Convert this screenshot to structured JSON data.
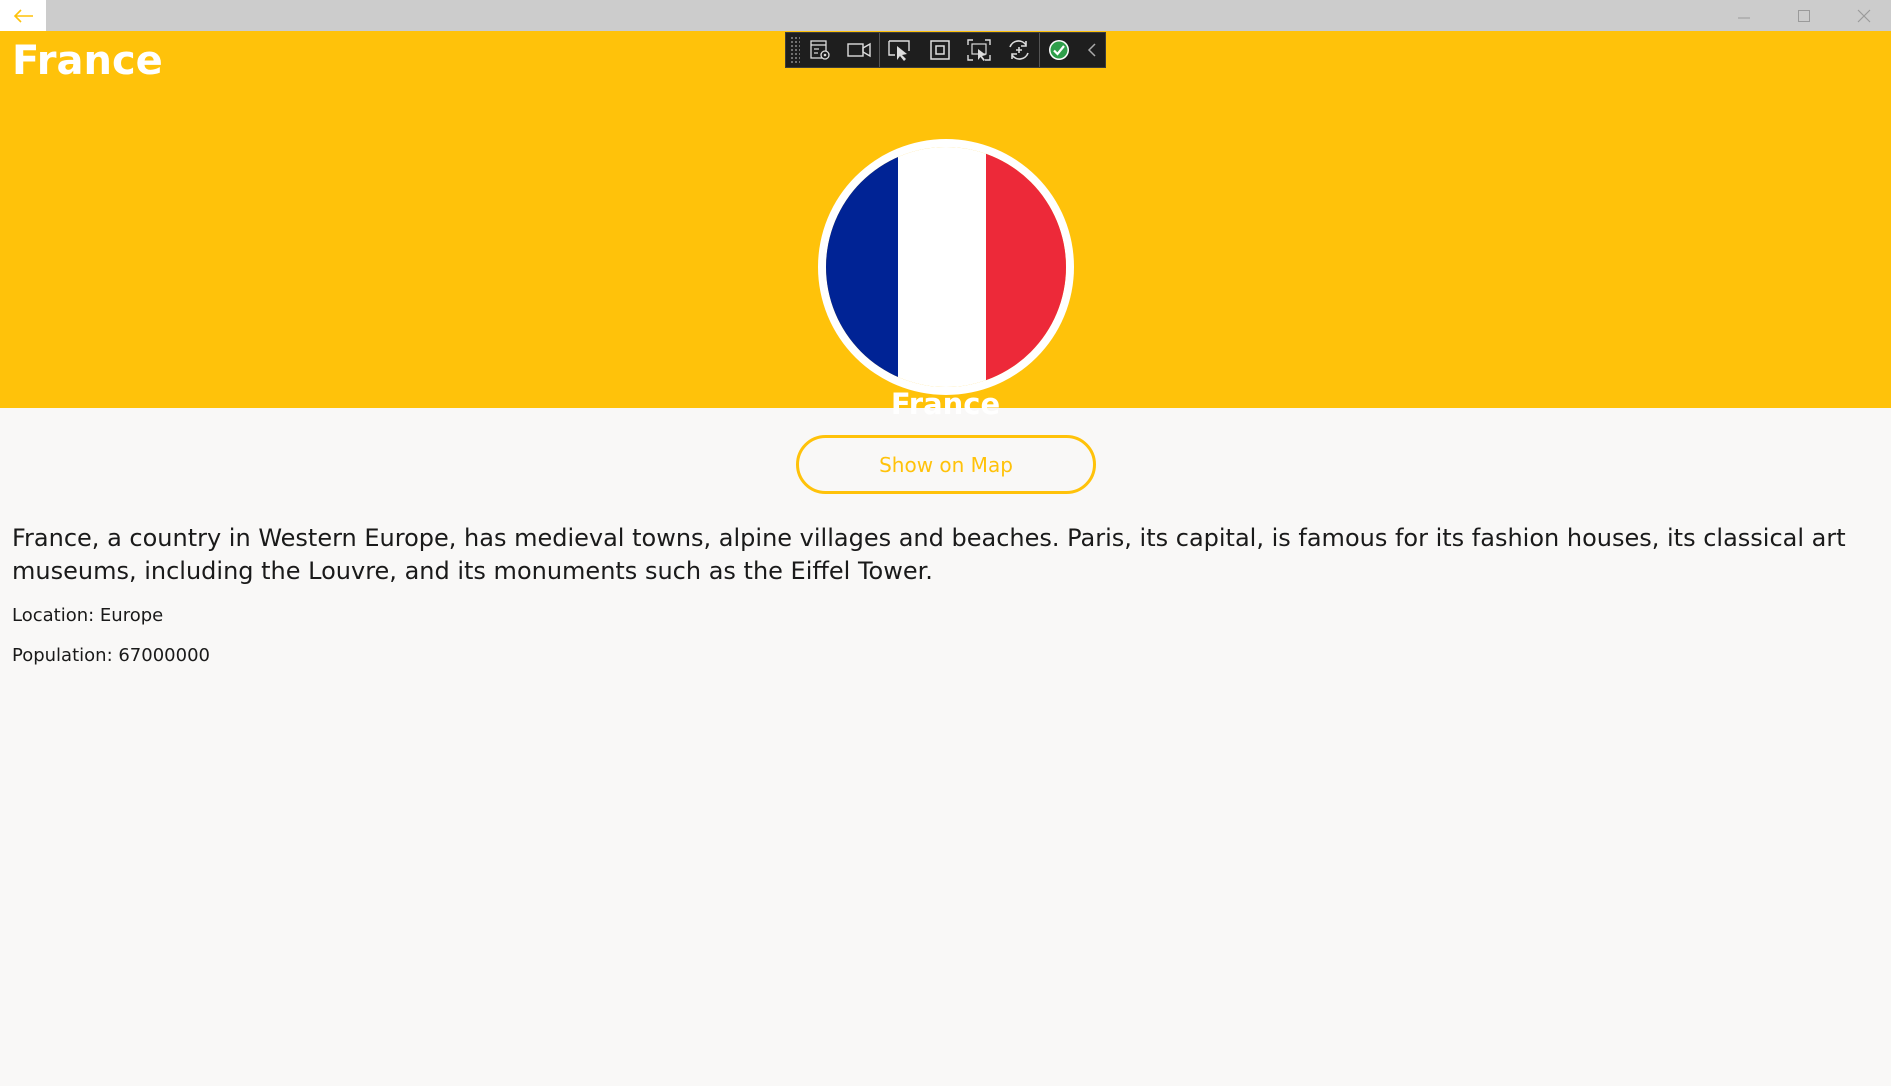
{
  "window": {
    "title": "France",
    "back_icon": "back-arrow-icon",
    "controls": [
      "minimize-icon",
      "maximize-icon",
      "close-icon"
    ]
  },
  "devtools_toolbar": {
    "tools": [
      "live-visual-tree-icon",
      "record-icon",
      "select-element-icon",
      "display-layout-adorners-icon",
      "track-focus-icon",
      "hot-reload-icon",
      "binding-failures-check-icon",
      "collapse-chevron-icon"
    ]
  },
  "header": {
    "title": "France",
    "flag_caption": "France",
    "flag_colors": [
      "#002395",
      "#ffffff",
      "#ed2939"
    ]
  },
  "actions": {
    "show_on_map": "Show on Map"
  },
  "details": {
    "description": "France, a country in Western Europe, has medieval towns, alpine villages and beaches. Paris, its capital, is famous for its fashion houses, its classical art museums, including the Louvre, and its monuments such as the Eiffel Tower.",
    "location": "Location: Europe",
    "population": "Population: 67000000"
  },
  "colors": {
    "accent": "#ffc20a",
    "background": "#f9f8f7",
    "titlebar": "#cccccc"
  }
}
